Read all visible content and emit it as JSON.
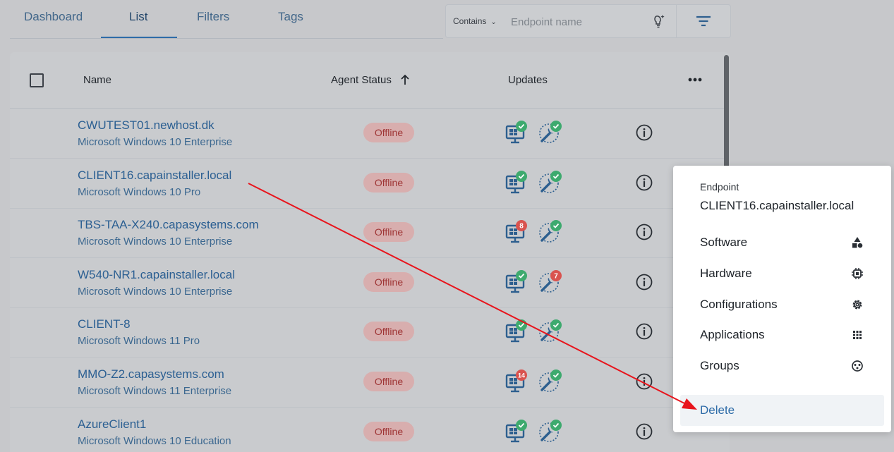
{
  "tabs": [
    {
      "label": "Dashboard",
      "active": false
    },
    {
      "label": "List",
      "active": true
    },
    {
      "label": "Filters",
      "active": false
    },
    {
      "label": "Tags",
      "active": false
    }
  ],
  "search": {
    "mode": "Contains",
    "placeholder": "Endpoint name",
    "value": ""
  },
  "table": {
    "columns": {
      "name": "Name",
      "agent_status": "Agent Status",
      "updates": "Updates"
    },
    "sort": {
      "column": "Agent Status",
      "direction": "ascending"
    },
    "rows": [
      {
        "name": "CWUTEST01.newhost.dk",
        "os": "Microsoft Windows 10 Enterprise",
        "status": "Offline",
        "windows_updates": "check",
        "software_updates": "check"
      },
      {
        "name": "CLIENT16.capainstaller.local",
        "os": "Microsoft Windows 10 Pro",
        "status": "Offline",
        "windows_updates": "check",
        "software_updates": "check"
      },
      {
        "name": "TBS-TAA-X240.capasystems.com",
        "os": "Microsoft Windows 10 Enterprise",
        "status": "Offline",
        "windows_updates": "8",
        "software_updates": "check"
      },
      {
        "name": "W540-NR1.capainstaller.local",
        "os": "Microsoft Windows 10 Enterprise",
        "status": "Offline",
        "windows_updates": "check",
        "software_updates": "7"
      },
      {
        "name": "CLIENT-8",
        "os": "Microsoft Windows 11 Pro",
        "status": "Offline",
        "windows_updates": "check",
        "software_updates": "check"
      },
      {
        "name": "MMO-Z2.capasystems.com",
        "os": "Microsoft Windows 11 Enterprise",
        "status": "Offline",
        "windows_updates": "14",
        "software_updates": "check"
      },
      {
        "name": "AzureClient1",
        "os": "Microsoft Windows 10 Education",
        "status": "Offline",
        "windows_updates": "check",
        "software_updates": "check"
      }
    ]
  },
  "context_menu": {
    "caption": "Endpoint",
    "title": "CLIENT16.capainstaller.local",
    "items": [
      {
        "label": "Software",
        "icon": "shapes-icon"
      },
      {
        "label": "Hardware",
        "icon": "chip-icon"
      },
      {
        "label": "Configurations",
        "icon": "gear-icon"
      },
      {
        "label": "Applications",
        "icon": "apps-grid-icon"
      },
      {
        "label": "Groups",
        "icon": "group-icon"
      },
      {
        "label": "Delete",
        "icon": ""
      }
    ]
  },
  "colors": {
    "accent": "#2e6ca8",
    "badge_ok": "#3daa6e",
    "badge_alert": "#d9534f",
    "status_offline_bg": "#d8aeae",
    "annotation_arrow": "#e8141c"
  }
}
